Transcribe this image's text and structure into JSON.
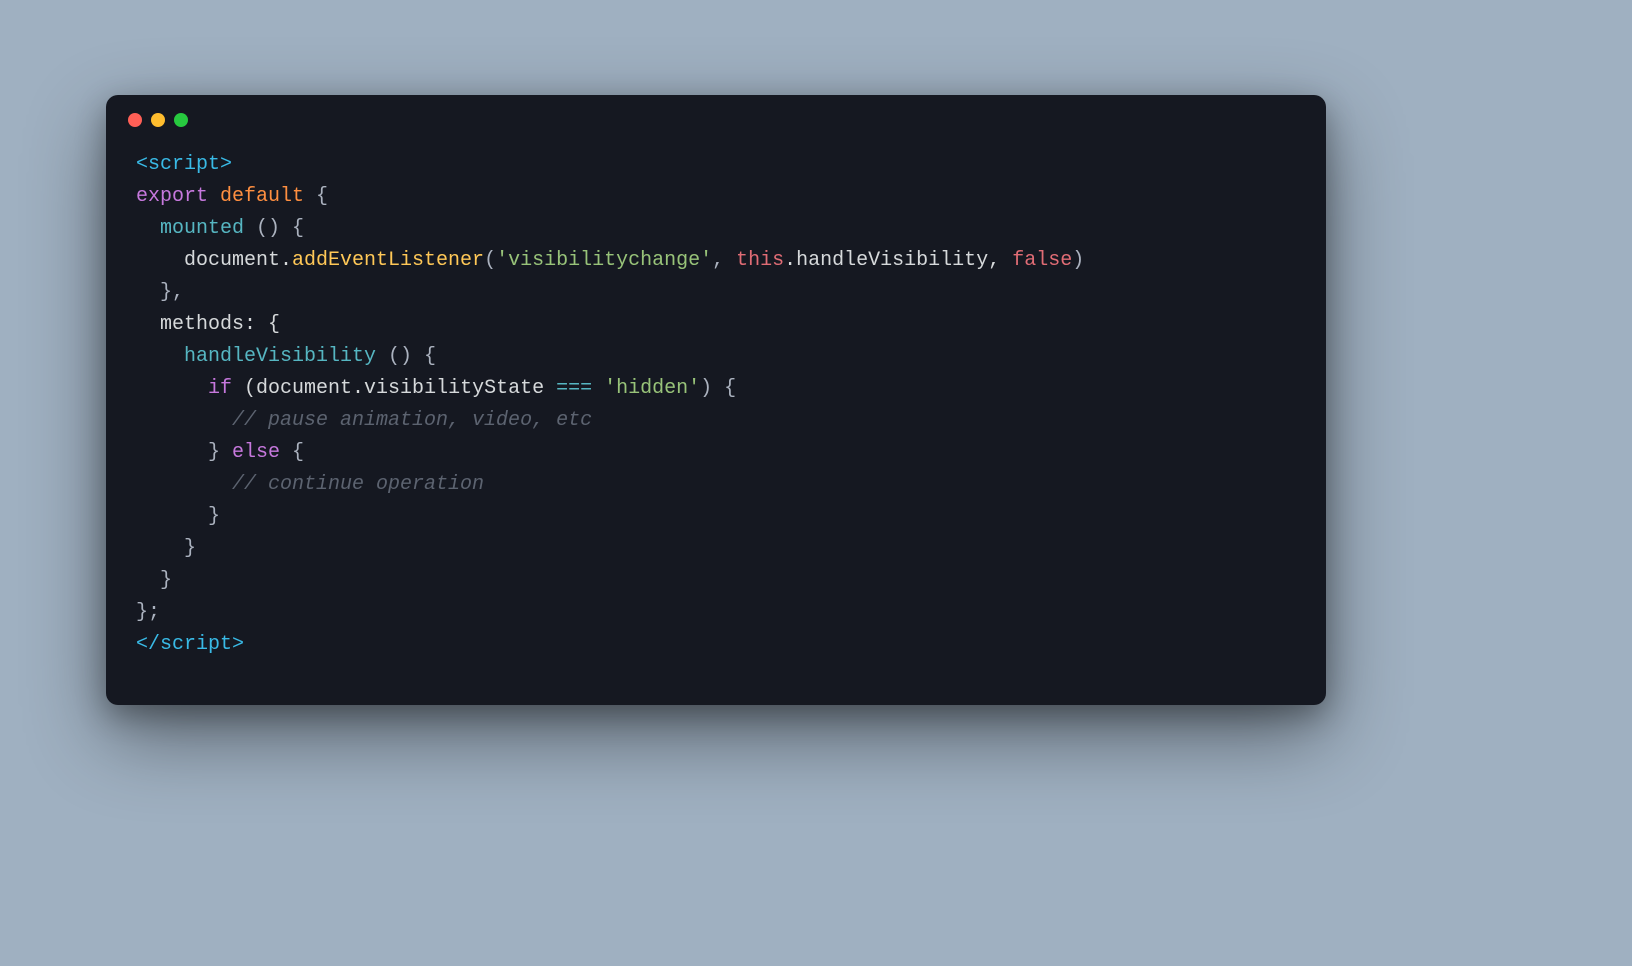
{
  "window": {
    "controls": [
      "close",
      "minimize",
      "zoom"
    ]
  },
  "code": {
    "tokens": [
      [
        {
          "t": "<script>",
          "c": "c-tag"
        }
      ],
      [
        {
          "t": "export",
          "c": "c-kw2"
        },
        {
          "t": " ",
          "c": "c-plain"
        },
        {
          "t": "default",
          "c": "c-kw"
        },
        {
          "t": " {",
          "c": "c-punc"
        }
      ],
      [
        {
          "t": "  ",
          "c": "c-plain"
        },
        {
          "t": "mounted",
          "c": "c-fn"
        },
        {
          "t": " () {",
          "c": "c-punc"
        }
      ],
      [
        {
          "t": "    document.",
          "c": "c-plain"
        },
        {
          "t": "addEventListener",
          "c": "c-method"
        },
        {
          "t": "(",
          "c": "c-punc"
        },
        {
          "t": "'visibilitychange'",
          "c": "c-str"
        },
        {
          "t": ", ",
          "c": "c-punc"
        },
        {
          "t": "this",
          "c": "c-this"
        },
        {
          "t": ".handleVisibility, ",
          "c": "c-plain"
        },
        {
          "t": "false",
          "c": "c-this"
        },
        {
          "t": ")",
          "c": "c-punc"
        }
      ],
      [
        {
          "t": "  },",
          "c": "c-punc"
        }
      ],
      [
        {
          "t": "  methods: {",
          "c": "c-plain"
        }
      ],
      [
        {
          "t": "    ",
          "c": "c-plain"
        },
        {
          "t": "handleVisibility",
          "c": "c-fn"
        },
        {
          "t": " () {",
          "c": "c-punc"
        }
      ],
      [
        {
          "t": "      ",
          "c": "c-plain"
        },
        {
          "t": "if",
          "c": "c-kw2"
        },
        {
          "t": " (document.visibilityState ",
          "c": "c-plain"
        },
        {
          "t": "===",
          "c": "c-op"
        },
        {
          "t": " ",
          "c": "c-plain"
        },
        {
          "t": "'hidden'",
          "c": "c-str"
        },
        {
          "t": ") {",
          "c": "c-punc"
        }
      ],
      [
        {
          "t": "        ",
          "c": "c-plain"
        },
        {
          "t": "// pause animation, video, etc",
          "c": "c-comment"
        }
      ],
      [
        {
          "t": "      } ",
          "c": "c-punc"
        },
        {
          "t": "else",
          "c": "c-kw2"
        },
        {
          "t": " {",
          "c": "c-punc"
        }
      ],
      [
        {
          "t": "        ",
          "c": "c-plain"
        },
        {
          "t": "// continue operation",
          "c": "c-comment"
        }
      ],
      [
        {
          "t": "      }",
          "c": "c-punc"
        }
      ],
      [
        {
          "t": "    }",
          "c": "c-punc"
        }
      ],
      [
        {
          "t": "  }",
          "c": "c-punc"
        }
      ],
      [
        {
          "t": "};",
          "c": "c-punc"
        }
      ],
      [
        {
          "t": "</scr",
          "c": "c-tag"
        },
        {
          "t": "ipt>",
          "c": "c-tag"
        }
      ]
    ]
  }
}
